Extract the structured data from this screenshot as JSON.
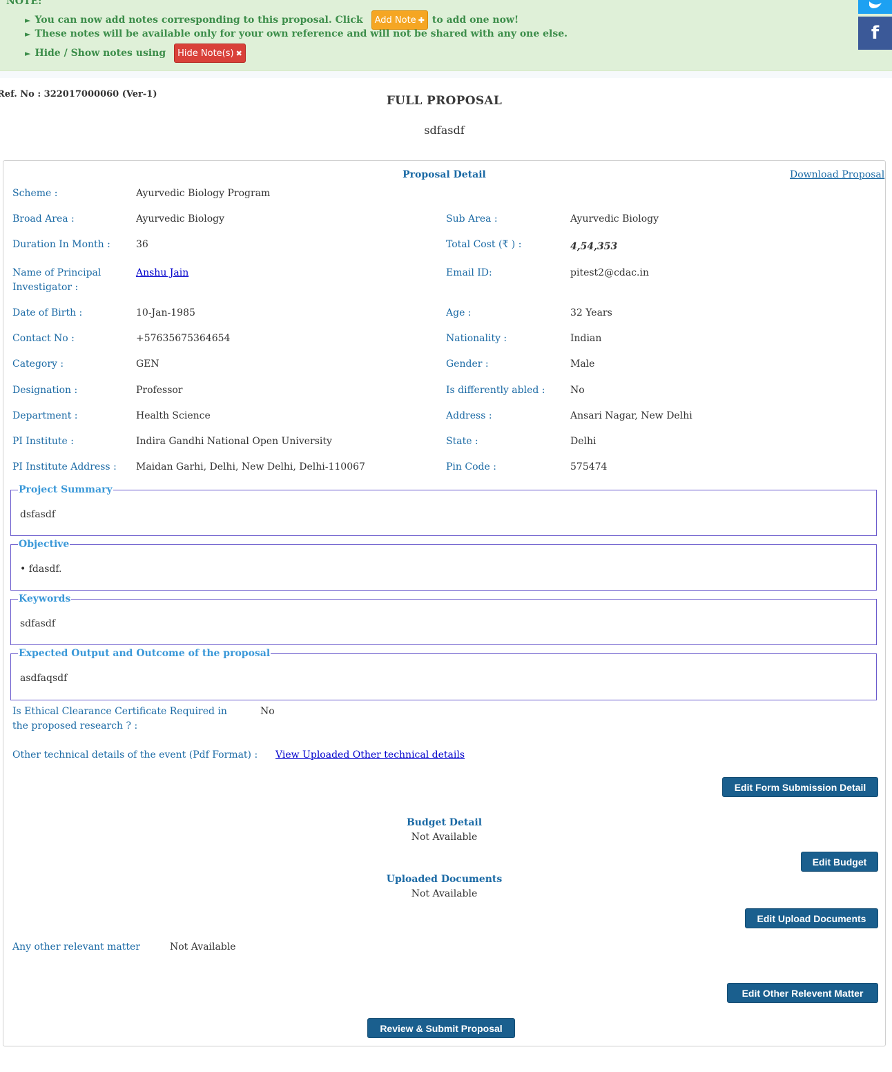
{
  "note": {
    "title": "NOTE:",
    "line1_before": "You can now add notes corresponding to this proposal. Click",
    "add_note_label": "Add Note",
    "line1_after": "to add one now!",
    "line2": "These notes will be available only for your own reference and will not be shared with any one else.",
    "line3": "Hide / Show notes using",
    "hide_note_label": "Hide Note(s)"
  },
  "social": {
    "facebook_label": "f"
  },
  "header": {
    "ref_no": "Ref. No : 322017000060 (Ver-1)",
    "title": "FULL PROPOSAL",
    "proposal_name": "sdfasdf"
  },
  "proposal_detail": {
    "heading": "Proposal Detail",
    "download_label": "Download Proposal",
    "scheme": {
      "label": "Scheme :",
      "value": "Ayurvedic Biology Program"
    },
    "broad_area": {
      "label": "Broad Area :",
      "value": "Ayurvedic Biology"
    },
    "sub_area": {
      "label": "Sub Area :",
      "value": "Ayurvedic Biology"
    },
    "duration": {
      "label": "Duration In Month :",
      "value": "36"
    },
    "total_cost": {
      "label": "Total Cost (₹ ) :",
      "value": "4,54,353"
    },
    "pi_name": {
      "label": "Name of Principal Investigator :",
      "value": "Anshu Jain"
    },
    "email": {
      "label": "Email ID:",
      "value": "pitest2@cdac.in"
    },
    "dob": {
      "label": "Date of Birth :",
      "value": "10-Jan-1985"
    },
    "age": {
      "label": "Age :",
      "value": "32 Years"
    },
    "contact": {
      "label": "Contact No :",
      "value": "+57635675364654"
    },
    "nationality": {
      "label": "Nationality :",
      "value": "Indian"
    },
    "category": {
      "label": "Category :",
      "value": "GEN"
    },
    "gender": {
      "label": "Gender :",
      "value": "Male"
    },
    "designation": {
      "label": "Designation :",
      "value": "Professor"
    },
    "differently_abled": {
      "label": "Is differently abled :",
      "value": "No"
    },
    "department": {
      "label": "Department :",
      "value": "Health Science"
    },
    "address": {
      "label": "Address :",
      "value": "Ansari Nagar, New Delhi"
    },
    "pi_institute": {
      "label": "PI Institute :",
      "value": "Indira Gandhi National Open University"
    },
    "state": {
      "label": "State :",
      "value": "Delhi"
    },
    "pi_institute_address": {
      "label": "PI Institute Address :",
      "value": "Maidan Garhi, Delhi, New Delhi, Delhi-110067"
    },
    "pin_code": {
      "label": "Pin Code :",
      "value": "575474"
    }
  },
  "fieldsets": {
    "project_summary": {
      "legend": "Project Summary",
      "content": "dsfasdf"
    },
    "objective": {
      "legend": "Objective",
      "content": "• fdasdf."
    },
    "keywords": {
      "legend": "Keywords",
      "content": "sdfasdf"
    },
    "expected_output": {
      "legend": "Expected Output and Outcome of the proposal",
      "content": "asdfaqsdf"
    }
  },
  "ethical": {
    "label": "Is Ethical Clearance Certificate Required in the proposed research ? :",
    "value": "No"
  },
  "other_technical": {
    "label": "Other technical details of the event (Pdf Format) :",
    "link": "View Uploaded Other technical details"
  },
  "buttons": {
    "edit_form": "Edit Form Submission Detail",
    "edit_budget": "Edit Budget",
    "edit_upload": "Edit Upload Documents",
    "edit_other": "Edit Other Relevent Matter",
    "review_submit": "Review & Submit Proposal"
  },
  "budget": {
    "heading": "Budget Detail",
    "value": "Not Available"
  },
  "uploaded": {
    "heading": "Uploaded Documents",
    "value": "Not Available"
  },
  "other_matter": {
    "label": "Any other relevant matter",
    "value": "Not Available"
  }
}
